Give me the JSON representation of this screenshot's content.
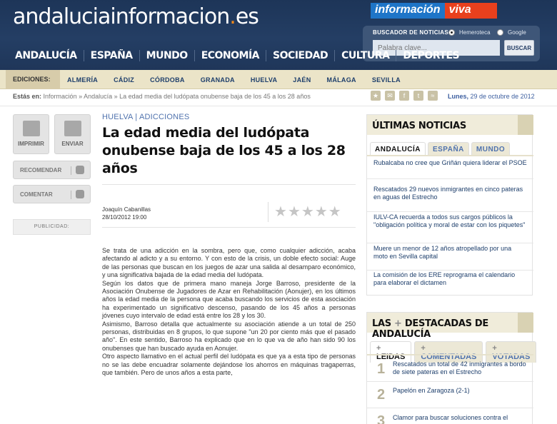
{
  "header": {
    "logo_main": "andaluciainformacion",
    "logo_dot": ".",
    "logo_tld": "es",
    "badge_a": "información",
    "badge_b": "viva",
    "search": {
      "title": "BUSCADOR DE NOTICIAS:",
      "option1": "Hemeroteca",
      "option2": "Google",
      "placeholder": "Palabra clave...",
      "button": "BUSCAR"
    }
  },
  "nav": [
    "ANDALUCÍA",
    "ESPAÑA",
    "MUNDO",
    "ECONOMÍA",
    "SOCIEDAD",
    "CULTURA",
    "DEPORTES"
  ],
  "editions": {
    "label": "EDICIONES:",
    "items": [
      "ALMERÍA",
      "CÁDIZ",
      "CÓRDOBA",
      "GRANADA",
      "HUELVA",
      "JAÉN",
      "MÁLAGA",
      "SEVILLA"
    ]
  },
  "breadcrumb": {
    "prefix": "Estás en:",
    "path": "Información » Andalucía » La edad media del ludópata onubense baja de los 45 a los 28 años"
  },
  "date": {
    "day": "Lunes,",
    "rest": "29 de octubre de 2012"
  },
  "left_tools": {
    "print": "IMPRIMIR",
    "send": "ENVIAR",
    "recommend": "RECOMENDAR",
    "comment": "COMENTAR",
    "ad": "PUBLICIDAD:"
  },
  "article": {
    "section": "HUELVA | ADICCIONES",
    "title": "La edad media del ludópata onubense baja de los 45 a los 28 años",
    "author": "Joaquín Cabanillas",
    "datetime": "28/10/2012 19:00",
    "rating": 0,
    "paragraphs": [
      "Se trata de una adicción en la sombra, pero que, como cualquier adicción, acaba afectando al adicto y a su entorno. Y con esto de la crisis, un doble efecto social: Auge de las personas que buscan en los juegos de azar una salida al desamparo económico, y una significativa bajada de la edad media del ludópata.",
      "Según los datos que de primera mano maneja Jorge Barroso, presidente de la Asociación Onubense de Jugadores de Azar en Rehabilitación (Aonujer), en los últimos años la edad media de la persona que acaba buscando los servicios de esta asociación ha experimentado un significativo descenso, pasando de los 45 años a personas jóvenes cuyo intervalo de edad está entre los 28 y los 30.",
      "Asimismo, Barroso detalla que actualmente su asociación atiende a un total de 250 personas, distribuidas en 8 grupos, lo que supone \"un 20 por ciento más que el pasado año\". En este sentido, Barroso ha explicado que en lo que va de año han sido 90 los onubenses que han buscado ayuda en Aonujer.",
      "Otro aspecto llamativo en el actual perfil del ludópata es que ya a esta tipo de personas no se las debe encuadrar solamente dejándose los ahorros en máquinas tragaperras, que también. Pero de unos años a esta parte,"
    ]
  },
  "ultimas": {
    "title": "ÚLTIMAS NOTICIAS",
    "tabs": [
      "ANDALUCÍA",
      "ESPAÑA",
      "MUNDO"
    ],
    "items": [
      "Rubalcaba no cree que Griñán quiera liderar el PSOE",
      "Rescatados 29 nuevos inmigrantes en cinco pateras en aguas del Estrecho",
      "IULV-CA recuerda a todos sus cargos públicos la \"obligación política y moral de estar con los piquetes\"",
      "Muere un menor de 12 años atropellado por una moto en Sevilla capital",
      "La comisión de los ERE reprograma el calendario para elaborar el dictamen"
    ]
  },
  "destacadas": {
    "title_a": "LAS",
    "title_plus": "+",
    "title_b": "DESTACADAS DE ANDALUCÍA",
    "tabs": [
      "LEIDAS",
      "COMENTADAS",
      "VOTADAS"
    ],
    "items": [
      {
        "n": "1",
        "text": "Rescatados un total de 42 inmigrantes a bordo de siete pateras en el Estrecho"
      },
      {
        "n": "2",
        "text": "Papelón en Zaragoza (2-1)"
      },
      {
        "n": "3",
        "text": "Clamor para buscar soluciones contra el"
      }
    ]
  }
}
